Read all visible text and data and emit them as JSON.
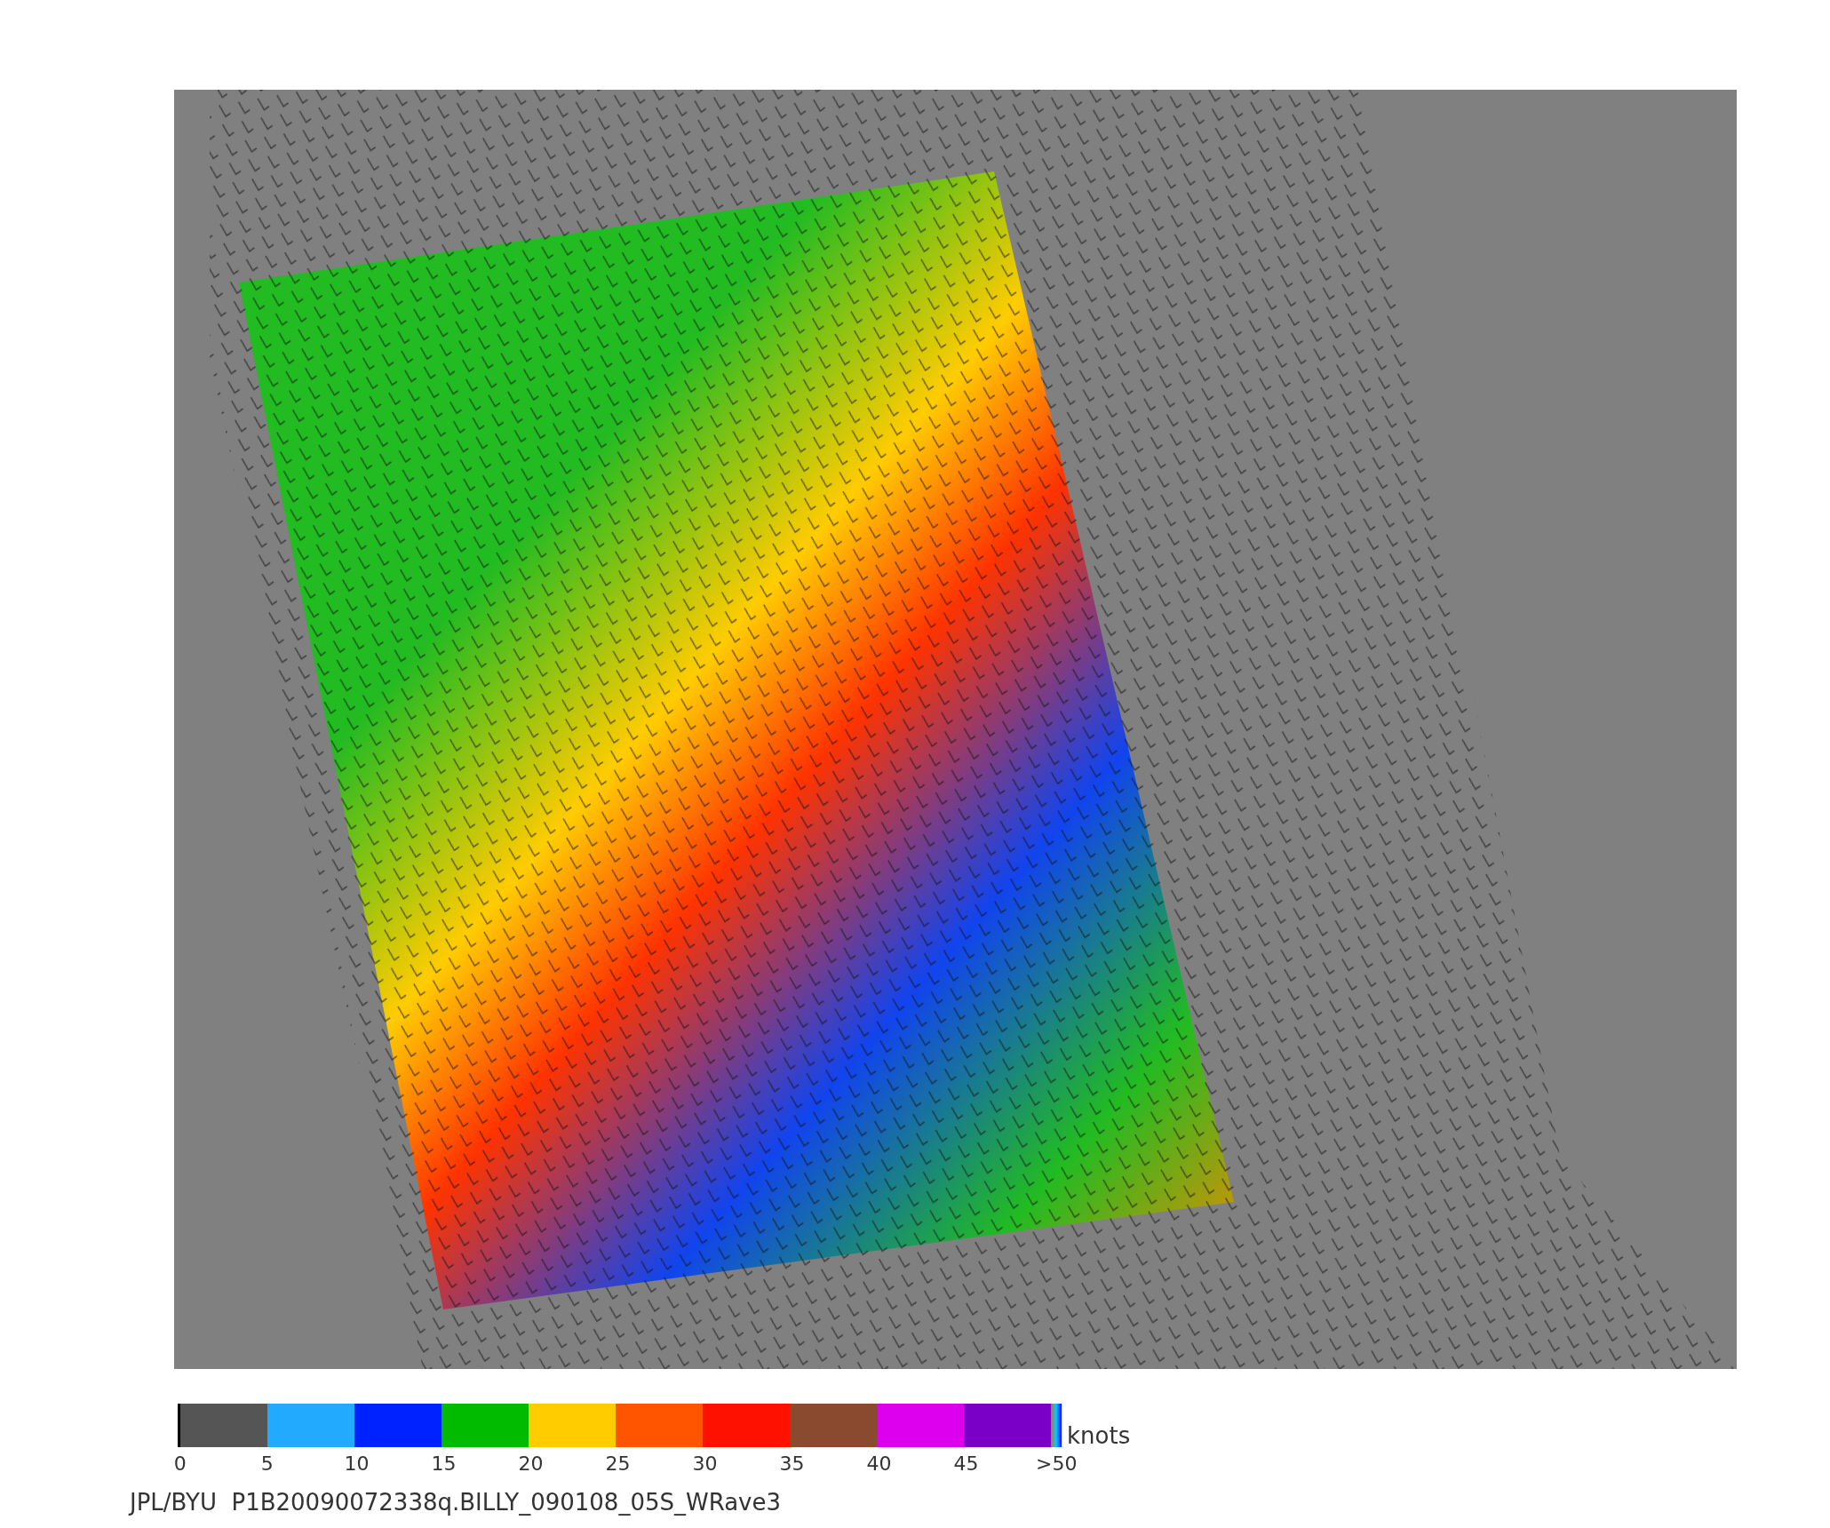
{
  "colorbar": {
    "unit": "knots",
    "segments": [
      {
        "color": "#555555"
      },
      {
        "color": "#22aaff"
      },
      {
        "color": "#0022ff"
      },
      {
        "color": "#00bb00"
      },
      {
        "color": "#ffcc00"
      },
      {
        "color": "#ff5500"
      },
      {
        "color": "#ff1100"
      },
      {
        "color": "#8a4a30"
      },
      {
        "color": "#dd00ee"
      },
      {
        "color": "#7a00c8"
      }
    ],
    "ticks": [
      "0",
      "5",
      "10",
      "15",
      "20",
      "25",
      "30",
      "35",
      "40",
      "45",
      ">50"
    ]
  },
  "caption": "JPL/BYU  P1B20090072338q.BILLY_090108_05S_WRave3"
}
